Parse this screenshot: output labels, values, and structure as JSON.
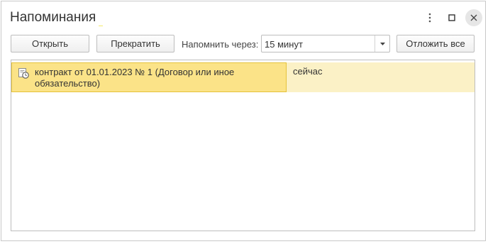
{
  "window": {
    "title": "Напоминания"
  },
  "toolbar": {
    "open_label": "Открыть",
    "stop_label": "Прекратить",
    "remind_label": "Напомнить через:",
    "remind_value": "15 минут",
    "postpone_all_label": "Отложить все"
  },
  "reminders": [
    {
      "icon": "reminder-clock-icon",
      "text": "контракт от 01.01.2023 № 1 (Договор или иное обязательство)",
      "time": "сейчас",
      "selected": true
    }
  ],
  "colors": {
    "selected_cell": "#fbe388",
    "row_highlight": "#fbf1c6",
    "selection_border": "#e5c23a"
  }
}
